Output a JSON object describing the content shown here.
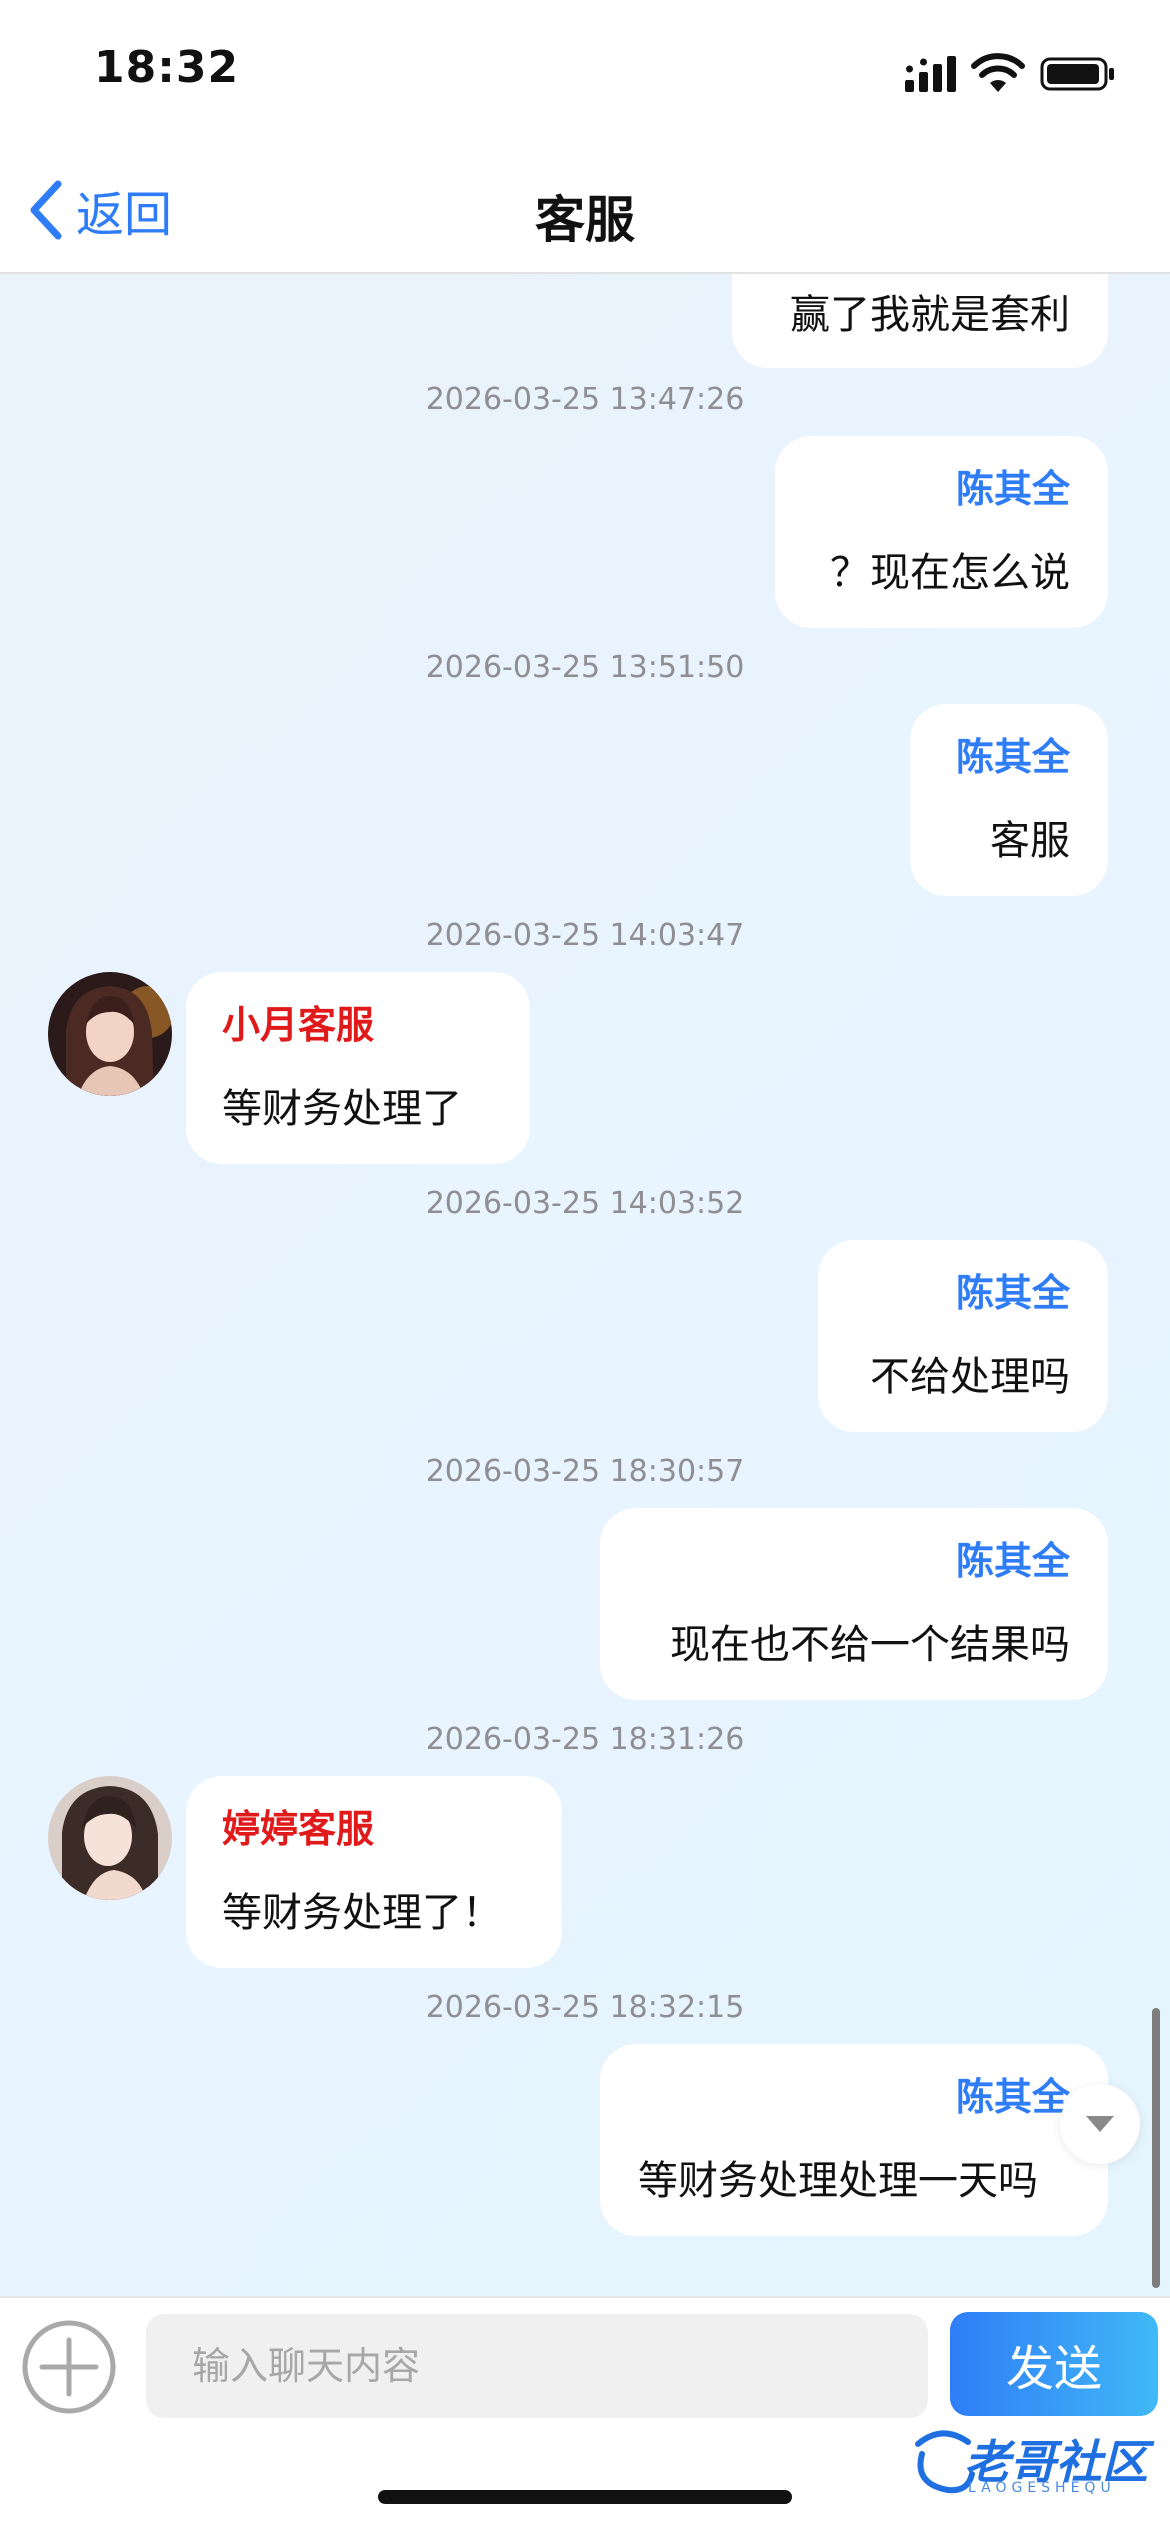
{
  "status_bar": {
    "time": "18:32"
  },
  "nav": {
    "back_label": "返回",
    "title": "客服"
  },
  "messages": [
    {
      "side": "out",
      "text": "赢了我就是套利"
    },
    {
      "timestamp": "2026-03-25 13:47:26",
      "side": "out",
      "sender": "陈其全",
      "text": "？现在怎么说"
    },
    {
      "timestamp": "2026-03-25 13:51:50",
      "side": "out",
      "sender": "陈其全",
      "text": "客服"
    },
    {
      "timestamp": "2026-03-25 14:03:47",
      "side": "in",
      "sender": "小月客服",
      "text": "等财务处理了"
    },
    {
      "timestamp": "2026-03-25 14:03:52",
      "side": "out",
      "sender": "陈其全",
      "text": "不给处理吗"
    },
    {
      "timestamp": "2026-03-25 18:30:57",
      "side": "out",
      "sender": "陈其全",
      "text": "现在也不给一个结果吗"
    },
    {
      "timestamp": "2026-03-25 18:31:26",
      "side": "in",
      "sender": "婷婷客服",
      "text": "等财务处理了！"
    },
    {
      "timestamp": "2026-03-25 18:32:15",
      "side": "out",
      "sender": "陈其全",
      "text": "等财务处理处理一天吗"
    }
  ],
  "input": {
    "placeholder": "输入聊天内容",
    "send_label": "发送"
  },
  "watermark": {
    "text": "老哥社区",
    "sub": "LAOGESHEQU"
  },
  "colors": {
    "accent": "#2f7df6",
    "agent_name": "#e01a1a"
  }
}
